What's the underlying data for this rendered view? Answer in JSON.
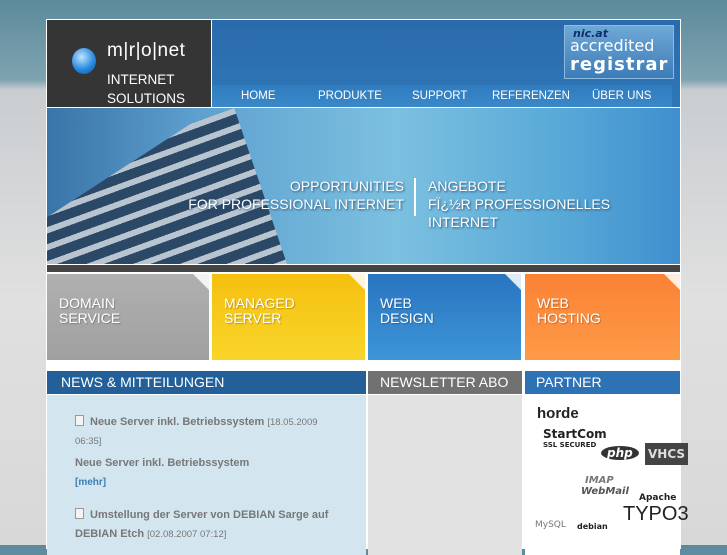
{
  "logo": {
    "brand": "m|r|o|net",
    "tagline1": "INTERNET",
    "tagline2": "SOLUTIONS"
  },
  "badge": {
    "nic": "nic.at",
    "line1": "accredited",
    "line2": "registrar"
  },
  "nav": [
    "HOME",
    "PRODUKTE",
    "SUPPORT",
    "REFERENZEN",
    "ÜBER UNS"
  ],
  "banner": {
    "en1": "OPPORTUNITIES",
    "en2": "FOR PROFESSIONAL INTERNET",
    "de1": "ANGEBOTE",
    "de2": "FÏ¿½R PROFESSIONELLES INTERNET"
  },
  "services": [
    {
      "l1": "DOMAIN",
      "l2": "SERVICE",
      "color": "#a8a8a8"
    },
    {
      "l1": "MANAGED",
      "l2": "SERVER",
      "color": "#f5c214"
    },
    {
      "l1": "WEB",
      "l2": "DESIGN",
      "color": "#2f80c8"
    },
    {
      "l1": "WEB",
      "l2": "HOSTING",
      "color": "#fb8a38"
    }
  ],
  "sections": {
    "news": "NEWS & MITTEILUNGEN",
    "newsletter": "NEWSLETTER ABO",
    "partner": "PARTNER"
  },
  "news": [
    {
      "title": "Neue Server inkl. Betriebssystem",
      "date": "[18.05.2009 06:35]",
      "teaser": "Neue Server inkl. Betriebssystem",
      "more": "[mehr]"
    },
    {
      "title": "Umstellung der Server von DEBIAN Sarge auf DEBIAN Etch",
      "date": "[02.08.2007 07:12]"
    }
  ],
  "partners": [
    "horde",
    "StartCom",
    "SSL SECURED",
    "php",
    "VHCS",
    "IMAP",
    "WebMail",
    "Apache",
    "MySQL",
    "debian",
    "TYPO3"
  ]
}
